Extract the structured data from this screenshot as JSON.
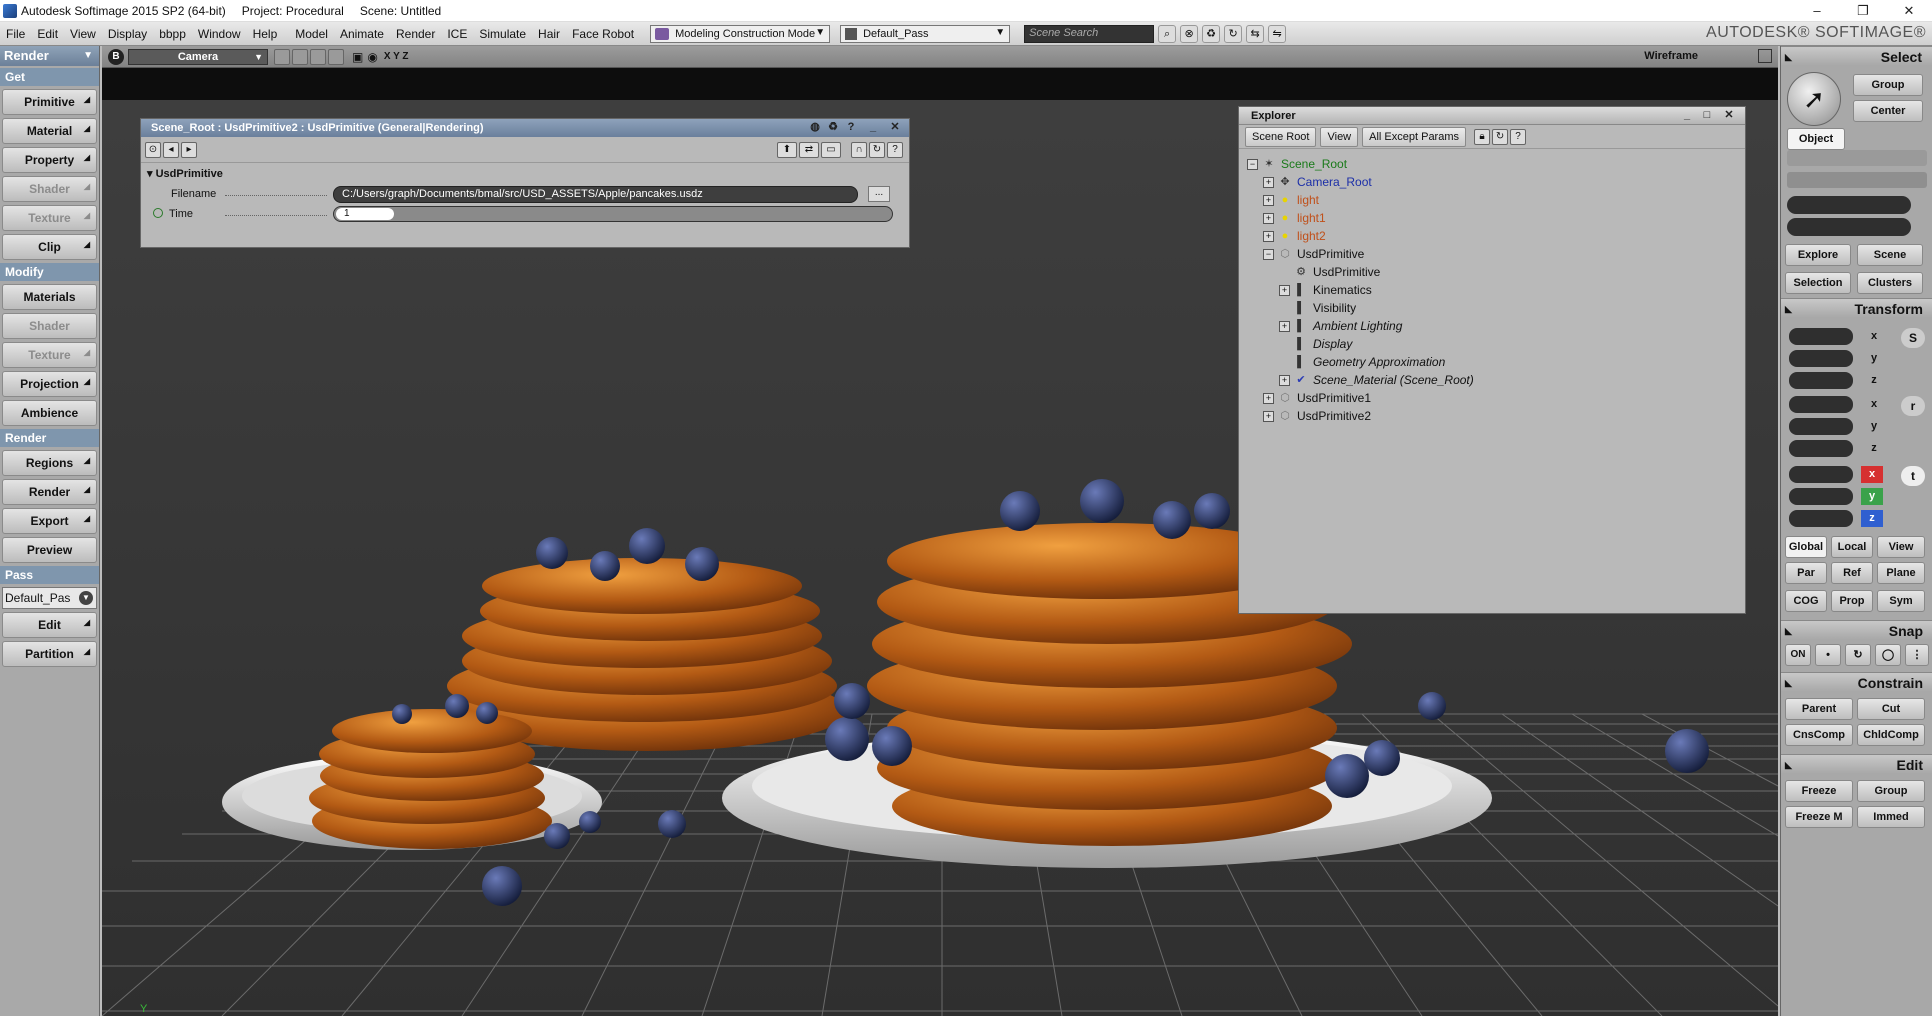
{
  "title_bar": {
    "app": "Autodesk Softimage 2015 SP2 (64-bit)",
    "project": "Project: Procedural",
    "scene": "Scene: Untitled",
    "minimize": "–",
    "restore": "❐",
    "close": "✕"
  },
  "menu": [
    "File",
    "Edit",
    "View",
    "Display",
    "bbpp",
    "Window",
    "Help",
    "Model",
    "Animate",
    "Render",
    "ICE",
    "Simulate",
    "Hair",
    "Face Robot"
  ],
  "toolbar": {
    "construction_mode": "Modeling Construction Mode",
    "pass": "Default_Pass",
    "search_placeholder": "Scene Search",
    "brand": "AUTODESK® SOFTIMAGE®"
  },
  "left_panel": {
    "module": "Render",
    "sections": {
      "get": "Get",
      "modify": "Modify",
      "render": "Render",
      "pass": "Pass"
    },
    "get_buttons": [
      "Primitive",
      "Material",
      "Property",
      "Shader",
      "Texture",
      "Clip"
    ],
    "modify_buttons": [
      "Materials",
      "Shader",
      "Texture",
      "Projection",
      "Ambience"
    ],
    "render_buttons": [
      "Regions",
      "Render",
      "Export",
      "Preview"
    ],
    "pass_value": "Default_Pas",
    "pass_buttons": [
      "Edit",
      "Partition"
    ]
  },
  "viewport": {
    "camera": "Camera",
    "axes": "X Y Z",
    "display_mode": "Wireframe",
    "axis_label": "Y"
  },
  "property_editor": {
    "title": "Scene_Root : UsdPrimitive2 : UsdPrimitive (General|Rendering)",
    "group": "UsdPrimitive",
    "filename_label": "Filename",
    "filename_value": "C:/Users/graph/Documents/bmal/src/USD_ASSETS/Apple/pancakes.usdz",
    "browse": "...",
    "time_label": "Time",
    "time_value": "1"
  },
  "explorer": {
    "title": "Explorer",
    "scope": "Scene Root",
    "view": "View",
    "filter": "All Except Params",
    "help": "?",
    "tree": [
      {
        "label": "Scene_Root",
        "depth": 0,
        "toggle": "−",
        "color": "#1a7a1a",
        "icon": "scene-root-icon"
      },
      {
        "label": "Camera_Root",
        "depth": 1,
        "toggle": "+",
        "color": "#1c2fa8",
        "icon": "camera-icon"
      },
      {
        "label": "light",
        "depth": 1,
        "toggle": "+",
        "color": "#c0501a",
        "icon": "light-icon"
      },
      {
        "label": "light1",
        "depth": 1,
        "toggle": "+",
        "color": "#c0501a",
        "icon": "light-icon"
      },
      {
        "label": "light2",
        "depth": 1,
        "toggle": "+",
        "color": "#c0501a",
        "icon": "light-icon"
      },
      {
        "label": "UsdPrimitive",
        "depth": 1,
        "toggle": "−",
        "color": "#111111",
        "icon": "primitive-icon"
      },
      {
        "label": "UsdPrimitive",
        "depth": 2,
        "toggle": "",
        "color": "#111111",
        "icon": "operator-icon"
      },
      {
        "label": "Kinematics",
        "depth": 2,
        "toggle": "+",
        "color": "#111111",
        "icon": "property-icon"
      },
      {
        "label": "Visibility",
        "depth": 2,
        "toggle": "",
        "color": "#111111",
        "icon": "property-icon"
      },
      {
        "label": "Ambient Lighting",
        "depth": 2,
        "toggle": "+",
        "color": "#111111",
        "icon": "property-icon",
        "italic": true
      },
      {
        "label": "Display",
        "depth": 2,
        "toggle": "",
        "color": "#111111",
        "icon": "property-icon",
        "italic": true
      },
      {
        "label": "Geometry Approximation",
        "depth": 2,
        "toggle": "",
        "color": "#111111",
        "icon": "property-icon",
        "italic": true
      },
      {
        "label": "Scene_Material (Scene_Root)",
        "depth": 2,
        "toggle": "+",
        "color": "#111111",
        "icon": "material-icon",
        "italic": true
      },
      {
        "label": "UsdPrimitive1",
        "depth": 1,
        "toggle": "+",
        "color": "#111111",
        "icon": "primitive-icon"
      },
      {
        "label": "UsdPrimitive2",
        "depth": 1,
        "toggle": "+",
        "color": "#111111",
        "icon": "primitive-icon"
      }
    ]
  },
  "right_panel": {
    "select": "Select",
    "group": "Group",
    "center": "Center",
    "object": "Object",
    "explore": "Explore",
    "scene": "Scene",
    "selection": "Selection",
    "clusters": "Clusters",
    "transform": "Transform",
    "x": "x",
    "y": "y",
    "z": "z",
    "s": "S",
    "r": "r",
    "t": "t",
    "global": "Global",
    "local": "Local",
    "view": "View",
    "par": "Par",
    "ref": "Ref",
    "plane": "Plane",
    "cog": "COG",
    "prop": "Prop",
    "sym": "Sym",
    "snap": "Snap",
    "on": "ON",
    "constrain": "Constrain",
    "parent": "Parent",
    "cut": "Cut",
    "cnscomp": "CnsComp",
    "chldcomp": "ChldComp",
    "edit": "Edit",
    "freeze": "Freeze",
    "group2": "Group",
    "freeze_m": "Freeze M",
    "immed": "Immed"
  }
}
